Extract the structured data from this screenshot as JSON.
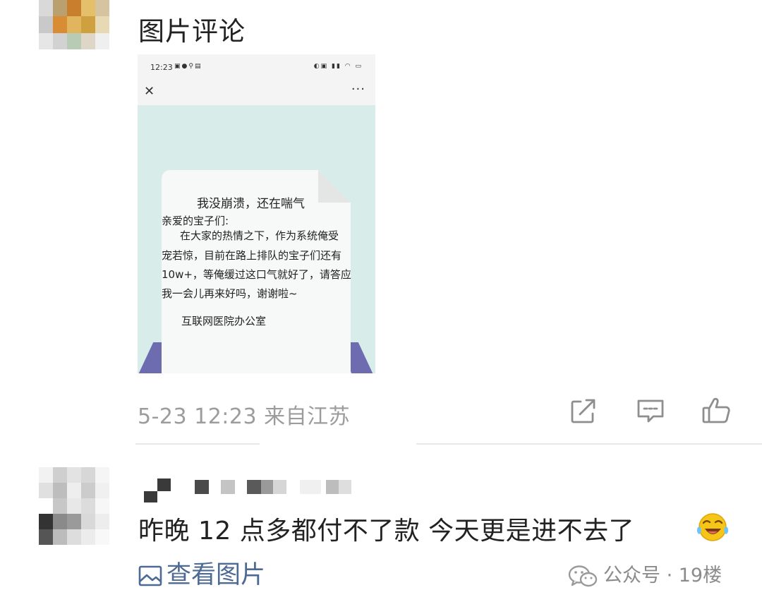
{
  "comment1": {
    "avatar_colors": [
      "#d9d9d9",
      "#b9a06e",
      "#c87e2c",
      "#e4c06a",
      "#d6c3a0",
      "#c9c9c9",
      "#d88d35",
      "#e1b55e",
      "#cfa03f",
      "#e8d9b5",
      "#e6e6e6",
      "#d2d2d2",
      "#b8cbb4",
      "#ded6c6",
      "#efefef"
    ],
    "text": "图片评论",
    "screenshot": {
      "status_time": "12:23",
      "notice_title": "我没崩溃，还在喘气",
      "greeting": "亲爱的宝子们:",
      "lines": [
        "在大家的热情之下，作为系统俺受",
        "宠若惊，目前在路上排队的宝子们还有",
        "10w+，等俺缓过这口气就好了，请答应",
        "我一会儿再来好吗，谢谢啦~"
      ],
      "signature": "互联网医院办公室"
    },
    "meta": "5-23 12:23 来自江苏",
    "actions": [
      "share-icon",
      "comment-icon",
      "thumbs-up-icon"
    ]
  },
  "comment2": {
    "avatar_colors": [
      "#f2f2f2",
      "#cfcfcf",
      "#e3e3e3",
      "#d7d7d7",
      "#f5f5f5",
      "#e0e0e0",
      "#bdbdbd",
      "#eeeeee",
      "#cccccc",
      "#f0f0f0",
      "#ffffff",
      "#c7c7c7",
      "#e8e8e8",
      "#dcdcdc",
      "#f7f7f7",
      "#333333",
      "#8a8a8a",
      "#9a9a9a",
      "#d9d9d9",
      "#ededed",
      "#555555",
      "#bcbcbc",
      "#dddddd",
      "#ececec",
      "#f8f8f8"
    ],
    "text": "昨晚 12 点多都付不了款 今天更是进不去了",
    "emoji": "laughing-crying-emoji",
    "view_pictures": "查看图片",
    "source": "公众号 · 19楼"
  }
}
